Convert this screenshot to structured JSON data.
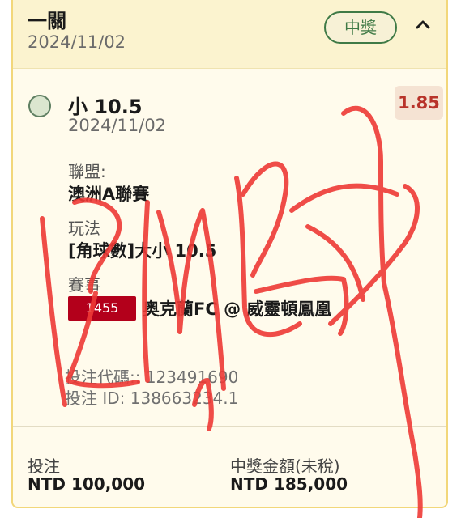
{
  "header": {
    "title": "一關",
    "date": "2024/11/02",
    "status_badge": "中獎",
    "collapse_icon": "chevron-up-icon"
  },
  "selection": {
    "title": "小 10.5",
    "date": "2024/11/02",
    "odds": "1.85",
    "league_label": "聯盟:",
    "league_value": "澳洲A聯賽",
    "market_label": "玩法",
    "market_value": "[角球數]大小 10.5",
    "event_label": "賽事",
    "event_id": "1455",
    "event_match": "奥克蘭FC @ 威靈頓鳳凰",
    "bet_code": "投注代碼:: 123491690",
    "bet_id": "投注 ID: 138663234.1"
  },
  "footer": {
    "stake_label": "投注",
    "stake_value": "NTD 100,000",
    "payout_label": "中獎金額(未稅)",
    "payout_value": "NTD 185,000"
  },
  "colors": {
    "card_bg": "#fffbec",
    "header_bg": "#fbf3cf",
    "border": "#f2d77a",
    "win_green": "#3f7a46",
    "odds_red": "#b8332a",
    "event_red": "#b3001b",
    "scribble_red": "#ee3a36"
  }
}
